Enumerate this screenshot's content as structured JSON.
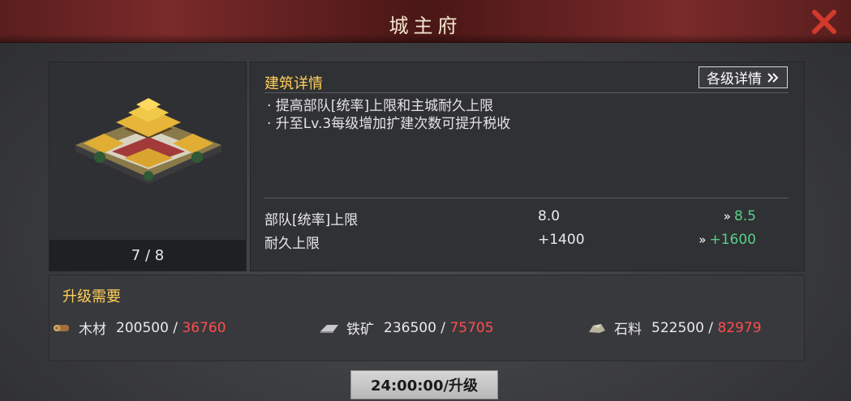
{
  "header": {
    "title": "城主府"
  },
  "building": {
    "level": "7 / 8"
  },
  "details": {
    "title": "建筑详情",
    "levels_button": "各级详情",
    "descriptions": [
      "· 提高部队[统率]上限和主城耐久上限",
      "· 升至Lv.3每级增加扩建次数可提升税收"
    ],
    "stats": [
      {
        "name": "部队[统率]上限",
        "current": "8.0",
        "next": "8.5"
      },
      {
        "name": "耐久上限",
        "current": "+1400",
        "next": "+1600"
      }
    ]
  },
  "requirements": {
    "title": "升级需要",
    "items": [
      {
        "icon": "wood-log-icon",
        "label": "木材",
        "have": "200500",
        "need": "36760"
      },
      {
        "icon": "iron-ore-icon",
        "label": "铁矿",
        "have": "236500",
        "need": "75705"
      },
      {
        "icon": "stone-icon",
        "label": "石料",
        "have": "522500",
        "need": "82979"
      }
    ],
    "separator": " / "
  },
  "upgrade_button": {
    "label": "24:00:00/升级"
  },
  "colors": {
    "accent_gold": "#ffcf59",
    "increase_green": "#56d08a",
    "deficit_red": "#ff4d4d"
  }
}
